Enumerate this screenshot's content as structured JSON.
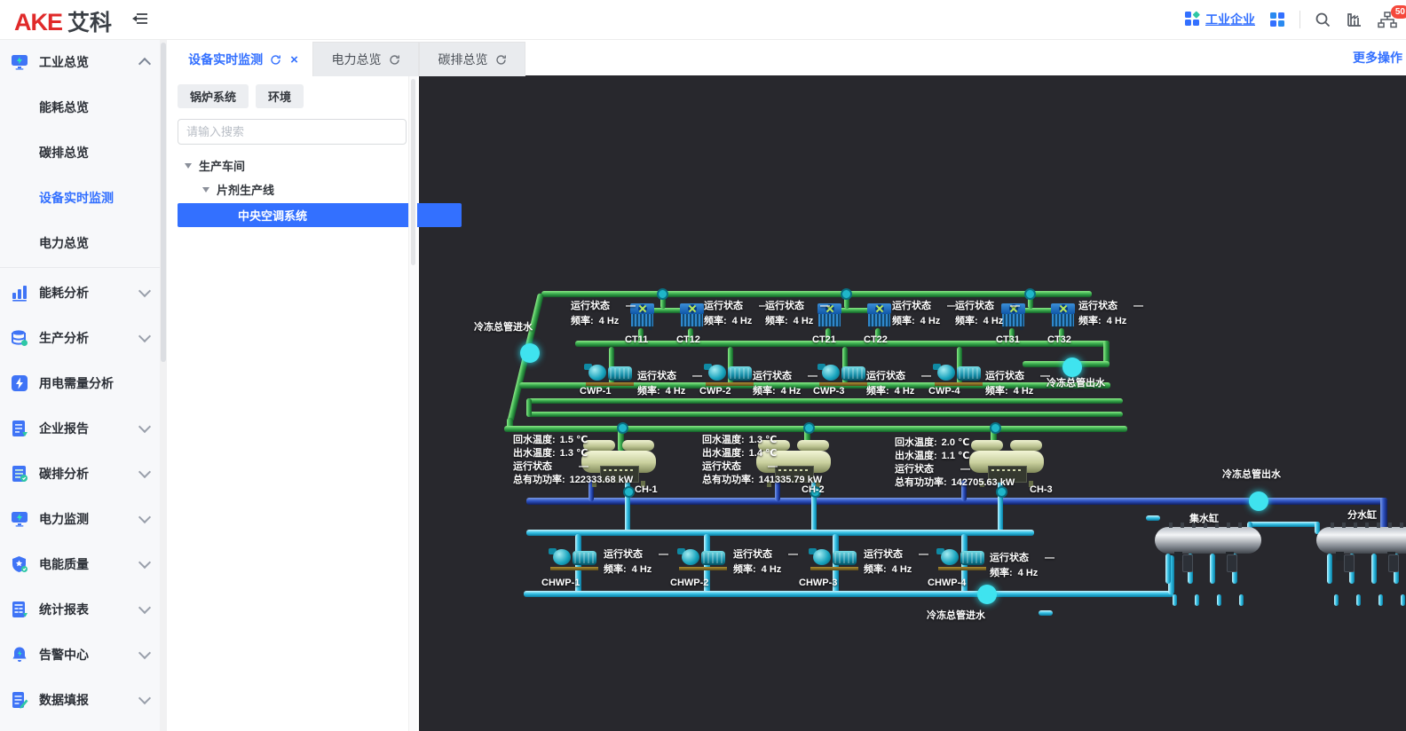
{
  "header": {
    "logo": "AKE",
    "logo_cn": "艾科",
    "enterprise_link": "工业企业",
    "notification_badge": "50"
  },
  "sidebar": {
    "overview": {
      "label": "工业总览"
    },
    "submenu": [
      {
        "label": "能耗总览"
      },
      {
        "label": "碳排总览"
      },
      {
        "label": "设备实时监测"
      },
      {
        "label": "电力总览"
      }
    ],
    "groups": [
      {
        "label": "能耗分析"
      },
      {
        "label": "生产分析"
      },
      {
        "label": "用电需量分析"
      },
      {
        "label": "企业报告"
      },
      {
        "label": "碳排分析"
      },
      {
        "label": "电力监测"
      },
      {
        "label": "电能质量"
      },
      {
        "label": "统计报表"
      },
      {
        "label": "告警中心"
      },
      {
        "label": "数据填报"
      }
    ]
  },
  "tabs": {
    "items": [
      {
        "label": "设备实时监测"
      },
      {
        "label": "电力总览"
      },
      {
        "label": "碳排总览"
      }
    ],
    "close_glyph": "×",
    "more": "更多操作"
  },
  "panel": {
    "buttons": [
      {
        "label": "锅炉系统"
      },
      {
        "label": "环境"
      }
    ],
    "search_placeholder": "请输入搜索",
    "tree": {
      "root": "生产车间",
      "line": "片剂生产线",
      "system": "中央空调系统"
    }
  },
  "diagram": {
    "background_color": "#28282d",
    "pipe_colors": {
      "condenser_green": "#38a94c",
      "chilled_cyan": "#33c0e4",
      "supply_blue": "#2c51c0"
    },
    "labels": {
      "chilled_main_inlet_left": "冷冻总管进水",
      "chilled_main_outlet_mid": "冷冻总管出水",
      "chilled_main_outlet_right": "冷冻总管出水",
      "chilled_main_inlet_bottom": "冷冻总管进水",
      "collector_tank": "集水缸",
      "distributor_tank": "分水缸"
    },
    "status": {
      "label": "运行状态",
      "value": "—",
      "freq_label": "频率:",
      "freq_value": "4 Hz"
    },
    "cooling_towers": [
      {
        "id": "CT11"
      },
      {
        "id": "CT12"
      },
      {
        "id": "CT21"
      },
      {
        "id": "CT22"
      },
      {
        "id": "CT31"
      },
      {
        "id": "CT32"
      }
    ],
    "cwp_pumps": [
      {
        "id": "CWP-1"
      },
      {
        "id": "CWP-2"
      },
      {
        "id": "CWP-3"
      },
      {
        "id": "CWP-4"
      }
    ],
    "chwp_pumps": [
      {
        "id": "CHWP-1"
      },
      {
        "id": "CHWP-2"
      },
      {
        "id": "CHWP-3"
      },
      {
        "id": "CHWP-4"
      }
    ],
    "chiller_field_labels": {
      "return_temp": "回水温度:",
      "supply_temp": "出水温度:",
      "status": "运行状态",
      "power": "总有功功率:"
    },
    "chillers": [
      {
        "id": "CH-1",
        "return_temp": "1.5 ℃",
        "supply_temp": "1.3 ℃",
        "status": "—",
        "power": "122333.68 kW"
      },
      {
        "id": "CH-2",
        "return_temp": "1.3 ℃",
        "supply_temp": "1.4 ℃",
        "status": "—",
        "power": "141335.79 kW"
      },
      {
        "id": "CH-3",
        "return_temp": "2.0 ℃",
        "supply_temp": "1.1 ℃",
        "status": "—",
        "power": "142705.63 kW"
      }
    ]
  }
}
